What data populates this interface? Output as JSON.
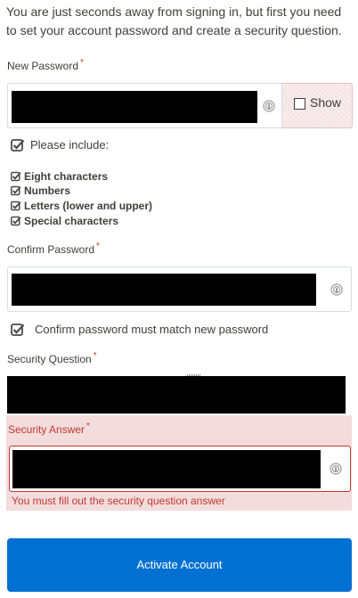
{
  "intro": {
    "text": "You are just seconds away from signing in, but first you need to set your account password and create a security question."
  },
  "new_password": {
    "label": "New Password",
    "required_marker": "*",
    "show_label": "Show"
  },
  "requirements": {
    "heading": "Please include:",
    "items": [
      {
        "label": "Eight characters",
        "met": true
      },
      {
        "label": "Numbers",
        "met": true
      },
      {
        "label": "Letters (lower and upper)",
        "met": true
      },
      {
        "label": "Special characters",
        "met": true
      }
    ]
  },
  "confirm_password": {
    "label": "Confirm Password",
    "required_marker": "*",
    "match_text": "Confirm password must match new password"
  },
  "security_question": {
    "label": "Security Question",
    "required_marker": "*"
  },
  "security_answer": {
    "label": "Security Answer",
    "required_marker": "*",
    "error": "You must fill out the security question answer"
  },
  "actions": {
    "activate_label": "Activate Account"
  },
  "colors": {
    "primary": "#0070d2",
    "error": "#c23934",
    "error_background": "#f3dcdc",
    "text": "#3e3e3c",
    "check_icon": "#4a4a4a"
  },
  "icons": {
    "fingerprint": "fingerprint-icon",
    "check": "check-square-icon"
  }
}
